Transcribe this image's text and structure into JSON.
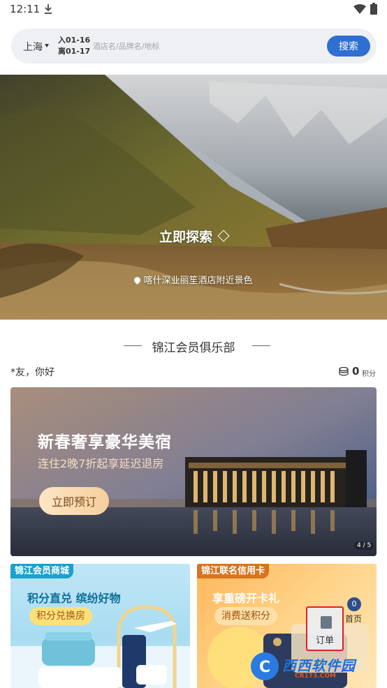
{
  "status_bar": {
    "time": "12:11"
  },
  "search": {
    "city": "上海",
    "checkin": "入01-16",
    "checkout": "离01-17",
    "placeholder": "酒店名/品牌名/地标",
    "button": "搜索"
  },
  "hero": {
    "cta": "立即探索",
    "location": "喀什深业丽笙酒店附近景色"
  },
  "club": {
    "title": "锦江会员俱乐部",
    "greeting": "*友，你好",
    "points_value": "0",
    "points_unit": "积分"
  },
  "promo": {
    "title": "新春奢享豪华美宿",
    "subtitle": "连住2晚7折起享延迟退房",
    "button": "立即预订",
    "page": "4 / 5"
  },
  "cards": {
    "left": {
      "tag": "锦江会员商城",
      "headline": "积分直兑  缤纷好物",
      "pill": "积分兑换房"
    },
    "right": {
      "tag": "锦江联名信用卡",
      "headline": "享重磅开卡礼",
      "pill": "消费送积分"
    }
  },
  "float_nav": {
    "order": "订单",
    "home": "首页",
    "home_badge": "0"
  },
  "watermark": {
    "text": "西西软件园",
    "url": "CR173.COM"
  }
}
